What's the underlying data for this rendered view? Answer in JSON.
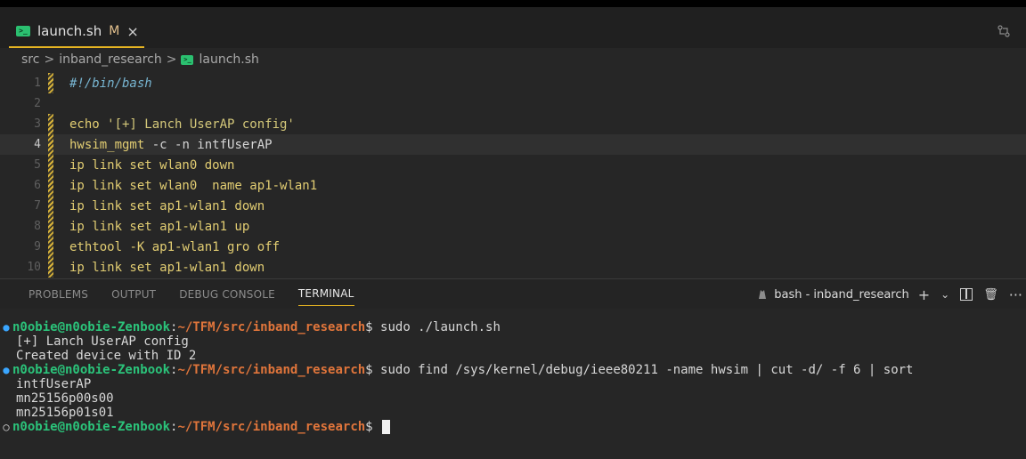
{
  "tab": {
    "title": "launch.sh",
    "badge": "M",
    "close": "×",
    "icon_text": ">_"
  },
  "breadcrumb": {
    "parts": [
      "src",
      "inband_research",
      "launch.sh"
    ],
    "sep": ">"
  },
  "editor": {
    "lines": [
      {
        "n": "1",
        "text": "#!/bin/bash"
      },
      {
        "n": "2",
        "text": ""
      },
      {
        "n": "3",
        "cmd": "echo",
        "rest": " '[+] Lanch UserAP config'"
      },
      {
        "n": "4",
        "cmd": "hwsim_mgmt",
        "rest": " -c -n intfUserAP"
      },
      {
        "n": "5",
        "cmd": "ip",
        "rest": " link set wlan0 down"
      },
      {
        "n": "6",
        "cmd": "ip",
        "rest": " link set wlan0  name ap1-wlan1"
      },
      {
        "n": "7",
        "cmd": "ip",
        "rest": " link set ap1-wlan1 down"
      },
      {
        "n": "8",
        "cmd": "ip",
        "rest": " link set ap1-wlan1 up"
      },
      {
        "n": "9",
        "cmd": "ethtool",
        "rest": " -K ap1-wlan1 gro off"
      },
      {
        "n": "10",
        "cmd": "ip",
        "rest": " link set ap1-wlan1 down"
      }
    ]
  },
  "panel": {
    "tabs": [
      "PROBLEMS",
      "OUTPUT",
      "DEBUG CONSOLE",
      "TERMINAL"
    ],
    "active_tab": "TERMINAL",
    "terminal_label": "bash - inband_research",
    "add": "+",
    "chevron": "⌄",
    "trash": "🗑",
    "more": "···"
  },
  "terminal": {
    "prompt_user": "n0obie@n0obie-Zenbook",
    "prompt_colon": ":",
    "prompt_path": "~/TFM/src/inband_research",
    "prompt_dollar": "$",
    "cmd1": " sudo ./launch.sh",
    "out1": "[+] Lanch UserAP config",
    "out2": "Created device with ID 2",
    "cmd2": " sudo find /sys/kernel/debug/ieee80211 -name hwsim | cut -d/ -f 6 | sort",
    "out3": "intfUserAP",
    "out4": "mn25156p00s00",
    "out5": "mn25156p01s01",
    "cmd3": " "
  },
  "colors": {
    "accent": "#e6b422",
    "prompt_user": "#2bc37a",
    "prompt_path": "#e0753b",
    "dot_success": "#3aa6ff"
  }
}
